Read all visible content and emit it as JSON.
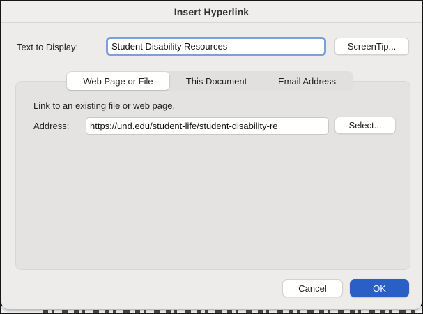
{
  "window": {
    "title": "Insert Hyperlink"
  },
  "fields": {
    "text_to_display": {
      "label": "Text to Display:",
      "value": "Student Disability Resources"
    },
    "address": {
      "label": "Address:",
      "value": "https://und.edu/student-life/student-disability-re"
    }
  },
  "tabs": [
    {
      "label": "Web Page or File",
      "selected": true
    },
    {
      "label": "This Document",
      "selected": false
    },
    {
      "label": "Email Address",
      "selected": false
    }
  ],
  "panel": {
    "description": "Link to an existing file or web page."
  },
  "buttons": {
    "screentip": "ScreenTip...",
    "select": "Select...",
    "cancel": "Cancel",
    "ok": "OK"
  },
  "colors": {
    "accent_blue": "#2a5fc6",
    "focus_ring": "#7ba1da",
    "dialog_bg": "#edecea",
    "groupbox_bg": "#e4e3e1"
  }
}
